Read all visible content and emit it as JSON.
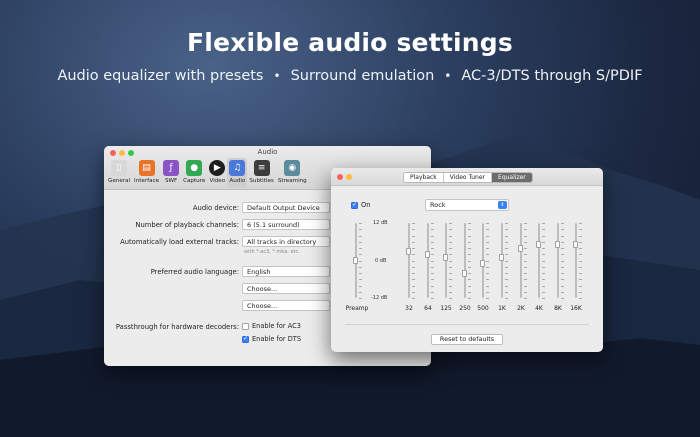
{
  "promo": {
    "headline": "Flexible audio settings",
    "features": [
      "Audio equalizer with presets",
      "Surround emulation",
      "AC-3/DTS through S/PDIF"
    ],
    "separator": "•"
  },
  "audio_window": {
    "title": "Audio",
    "toolbar": [
      {
        "label": "General",
        "icon": "switch-icon",
        "color": "#d8d8d8"
      },
      {
        "label": "Interface",
        "icon": "interface-icon",
        "color": "#e8732a"
      },
      {
        "label": "SWF",
        "icon": "swf-icon",
        "color": "#8a54c6"
      },
      {
        "label": "Capture",
        "icon": "capture-icon",
        "color": "#33a853"
      },
      {
        "label": "Video",
        "icon": "play-icon",
        "color": "#1f1f1f"
      },
      {
        "label": "Audio",
        "icon": "music-note-icon",
        "color": "#4b79d8",
        "active": true
      },
      {
        "label": "Subtitles",
        "icon": "subtitles-icon",
        "color": "#3d3d3d"
      },
      {
        "label": "Streaming",
        "icon": "streaming-icon",
        "color": "#5a8c9c"
      }
    ],
    "rows": {
      "audio_device": {
        "label": "Audio device:",
        "value": "Default Output Device"
      },
      "channels": {
        "label": "Number of playback channels:",
        "value": "6 (5.1 surround)"
      },
      "external_tracks": {
        "label": "Automatically load external tracks:",
        "value": "All tracks in directory",
        "hint": "with *.ac3, *.mka, etc."
      },
      "language": {
        "label": "Preferred audio language:",
        "value": "English"
      },
      "choose1": {
        "value": "Choose..."
      },
      "choose2": {
        "value": "Choose..."
      },
      "passthrough": {
        "label": "Passthrough for hardware decoders:",
        "ac3": "Enable for AC3",
        "ac3_checked": false,
        "dts": "Enable for DTS",
        "dts_checked": true
      }
    }
  },
  "eq_window": {
    "tabs": [
      {
        "label": "Playback",
        "active": false
      },
      {
        "label": "Video Tuner",
        "active": false
      },
      {
        "label": "Equalizer",
        "active": true
      }
    ],
    "on_label": "On",
    "on_checked": true,
    "preset": "Rock",
    "db_labels": {
      "max": "12 dB",
      "mid": "0 dB",
      "min": "-12 dB"
    },
    "preamp_label": "Preamp",
    "preamp_value": 0,
    "bands": [
      {
        "label": "32",
        "value": 3
      },
      {
        "label": "64",
        "value": 2
      },
      {
        "label": "125",
        "value": 1
      },
      {
        "label": "250",
        "value": -4
      },
      {
        "label": "500",
        "value": -1
      },
      {
        "label": "1K",
        "value": 1
      },
      {
        "label": "2K",
        "value": 4
      },
      {
        "label": "4K",
        "value": 5
      },
      {
        "label": "8K",
        "value": 5
      },
      {
        "label": "16K",
        "value": 5
      }
    ],
    "reset_label": "Reset to defaults"
  }
}
